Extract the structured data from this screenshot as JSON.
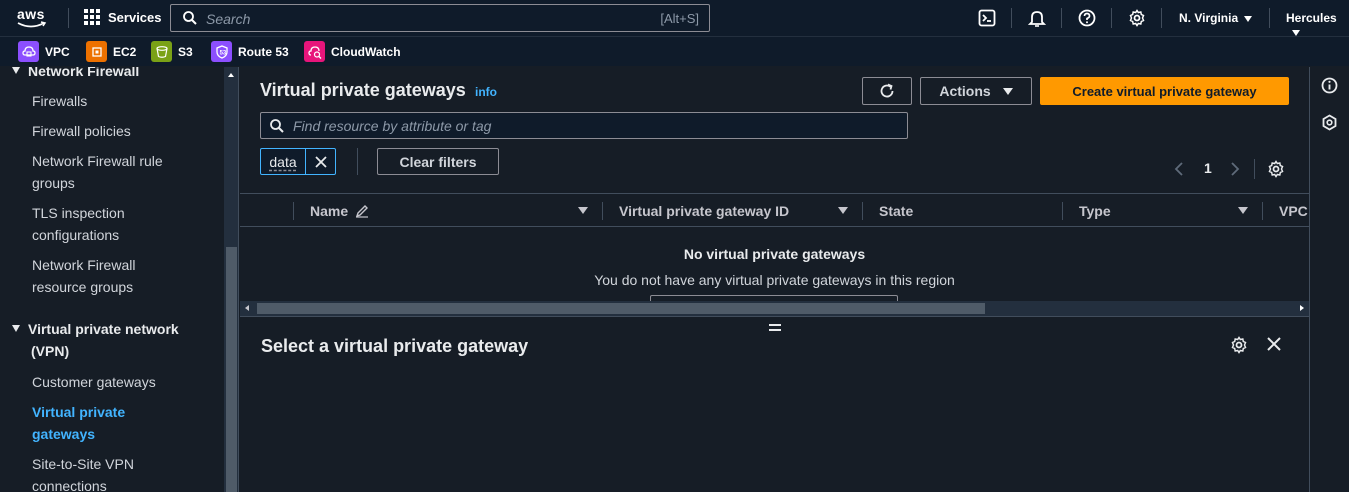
{
  "topnav": {
    "logo_text": "aws",
    "services_label": "Services",
    "search_placeholder": "Search",
    "search_shortcut": "[Alt+S]",
    "region": "N. Virginia",
    "user": "Hercules"
  },
  "favorites": [
    {
      "label": "VPC",
      "color": "#8c4fff"
    },
    {
      "label": "EC2",
      "color": "#ed7100"
    },
    {
      "label": "S3",
      "color": "#7aa116"
    },
    {
      "label": "Route 53",
      "color": "#8c4fff"
    },
    {
      "label": "CloudWatch",
      "color": "#e7157b"
    }
  ],
  "sidebar": {
    "section_network_firewall": "Network Firewall",
    "items_nf": [
      "Firewalls",
      "Firewall policies",
      "Network Firewall rule groups",
      "TLS inspection configurations",
      "Network Firewall resource groups"
    ],
    "section_vpn": "Virtual private network (VPN)",
    "items_vpn": [
      "Customer gateways",
      "Virtual private gateways",
      "Site-to-Site VPN connections"
    ]
  },
  "main": {
    "title": "Virtual private gateways",
    "info": "info",
    "actions_label": "Actions",
    "create_label": "Create virtual private gateway",
    "filter_placeholder": "Find resource by attribute or tag",
    "token_label": "data",
    "clear_filters": "Clear filters",
    "page_number": "1",
    "columns": [
      "Name",
      "Virtual private gateway ID",
      "State",
      "Type",
      "VPC"
    ],
    "empty_title": "No virtual private gateways",
    "empty_subtitle": "You do not have any virtual private gateways in this region"
  },
  "detail": {
    "title": "Select a virtual private gateway"
  },
  "colors": {
    "accent": "#ff9900",
    "link": "#42b4ff",
    "nav_bg": "#0f1b2a",
    "page_bg": "#161d26"
  }
}
